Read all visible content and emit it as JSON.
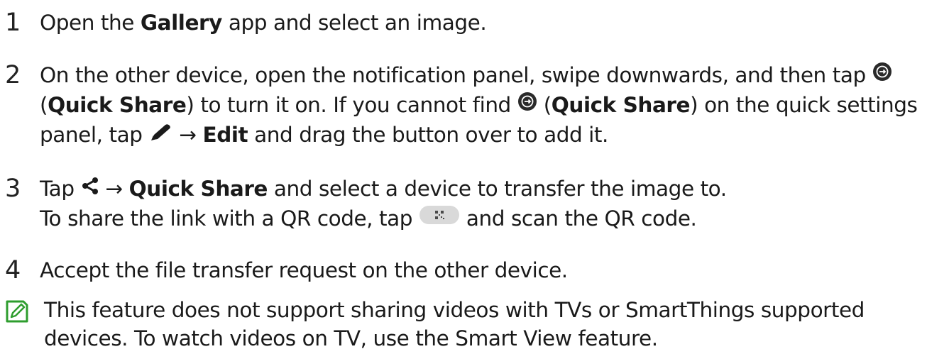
{
  "steps": [
    {
      "number": "1",
      "lines": [
        [
          "Open the ",
          "Gallery",
          " app and select an image."
        ]
      ]
    },
    {
      "number": "2",
      "line1": {
        "t1": "On the other device, open the notification panel, swipe downwards, and then tap"
      },
      "line2": {
        "t1": "(",
        "b1": "Quick Share",
        "t2": ") to turn it on. If you cannot find ",
        "t3": " (",
        "b2": "Quick Share",
        "t4": ") on the quick settings"
      },
      "line3": {
        "t1": "panel, tap ",
        "arrow": " → ",
        "b1": "Edit",
        "t2": " and drag the button over to add it."
      }
    },
    {
      "number": "3",
      "line1": {
        "t1": "Tap ",
        "arrow": " → ",
        "b1": "Quick Share",
        "t2": " and select a device to transfer the image to."
      },
      "line2": {
        "t1": "To share the link with a QR code, tap ",
        "t2": " and scan the QR code."
      }
    },
    {
      "number": "4",
      "lines": [
        [
          "Accept the file transfer request on the other device."
        ]
      ]
    }
  ],
  "note": {
    "line1": "This feature does not support sharing videos with TVs or SmartThings supported",
    "line2": "devices. To watch videos on TV, use the Smart View feature."
  },
  "icons": {
    "quick_share": "quick-share-icon",
    "edit": "pencil-icon",
    "share": "share-icon",
    "qr": "qr-code-icon",
    "note": "note-icon"
  },
  "colors": {
    "text": "#1a1a1a",
    "note_icon": "#2e9d2e",
    "quick_share_fill": "#2a2a2a",
    "qr_pill": "#d9d9d9"
  }
}
